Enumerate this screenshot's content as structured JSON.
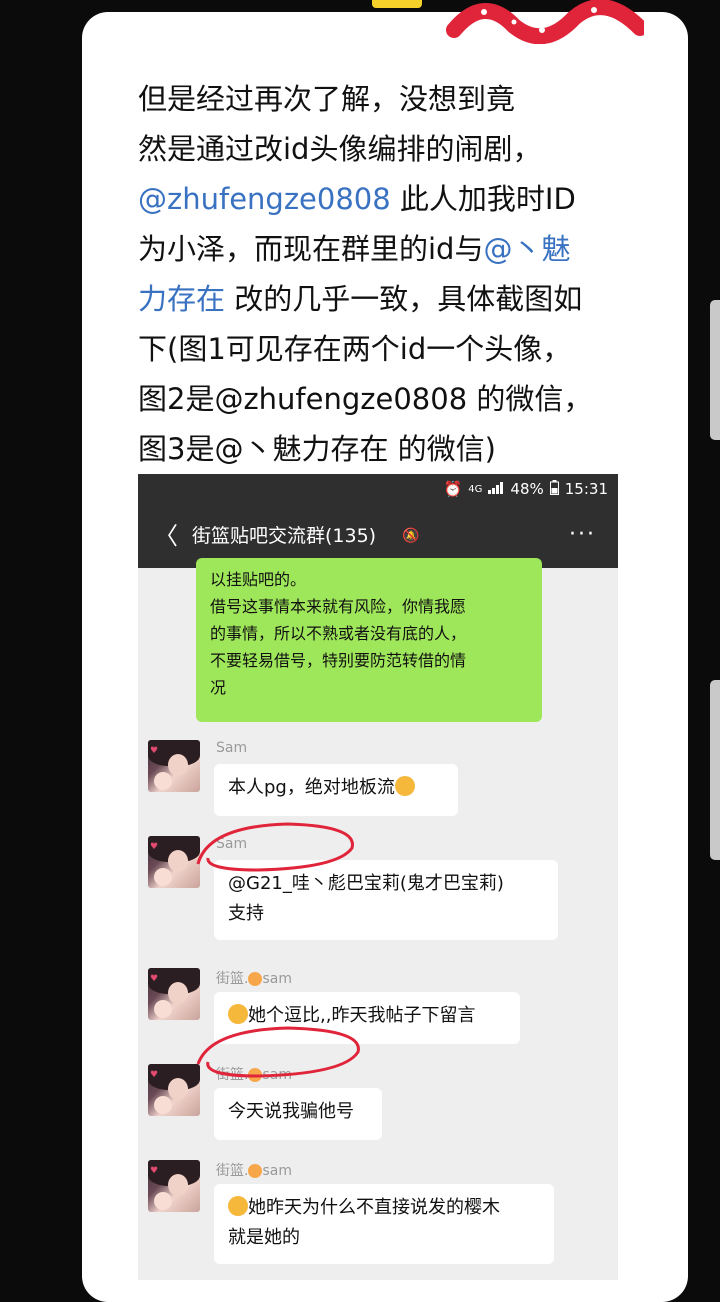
{
  "post": {
    "lines": [
      [
        {
          "t": "但是经过再次了解，没想到竟"
        }
      ],
      [
        {
          "t": "然是通过改id头像编排的闹剧，"
        }
      ],
      [
        {
          "t": "@zhufengze0808",
          "m": true
        },
        {
          "t": "  此人加我时ID"
        }
      ],
      [
        {
          "t": "为小泽，而现在群里的id与"
        },
        {
          "t": "@丶魅",
          "m": true
        }
      ],
      [
        {
          "t": "力存在",
          "m": true
        },
        {
          "t": "  改的几乎一致，具体截图如"
        }
      ],
      [
        {
          "t": "下(图1可见存在两个id一个头像，"
        }
      ],
      [
        {
          "t": "图2是@zhufengze0808 的微信，"
        }
      ],
      [
        {
          "t": "图3是@丶魅力存在 的微信)"
        }
      ]
    ]
  },
  "screenshot": {
    "statusbar": {
      "alarm_icon": "alarm-icon",
      "network": "4G",
      "signal_icon": "signal-icon",
      "battery": "48%",
      "battery_icon": "battery-icon",
      "time": "15:31"
    },
    "chat": {
      "back_label": "〈",
      "title": "街篮贴吧交流群(135)",
      "mute_icon": "bell-muted-icon",
      "more_label": "···"
    },
    "green_bubble": {
      "lines": [
        "以挂贴吧的。",
        "借号这事情本来就有风险，你情我愿",
        "的事情，所以不熟或者没有底的人，",
        "不要轻易借号，特别要防范转借的情",
        "况"
      ]
    },
    "messages": [
      {
        "sender": "Sam",
        "lines": [
          "本人pg，绝对地板流"
        ],
        "trail_emoji": "grin-emoji"
      },
      {
        "sender": "Sam",
        "lines": [
          "@G21_哇丶彪巴宝莉(鬼才巴宝莉)",
          "支持"
        ]
      },
      {
        "sender_prefix": "街篮.",
        "sender_suffix": "sam",
        "lines": [
          "她个逗比,,昨天我帖子下留言"
        ],
        "lead_emoji": "smirk-emoji"
      },
      {
        "sender_prefix": "街篮.",
        "sender_suffix": "sam",
        "lines": [
          "今天说我骗他号"
        ]
      },
      {
        "sender_prefix": "街篮.",
        "sender_suffix": "sam",
        "lines": [
          "她昨天为什么不直接说发的樱木",
          "就是她的"
        ],
        "lead_emoji": "thinking-emoji"
      }
    ]
  },
  "colors": {
    "mention": "#3a72c2",
    "green_bubble": "#9fe75a",
    "annotation_red": "#e0243a",
    "header_bg": "#2f2f2f"
  }
}
